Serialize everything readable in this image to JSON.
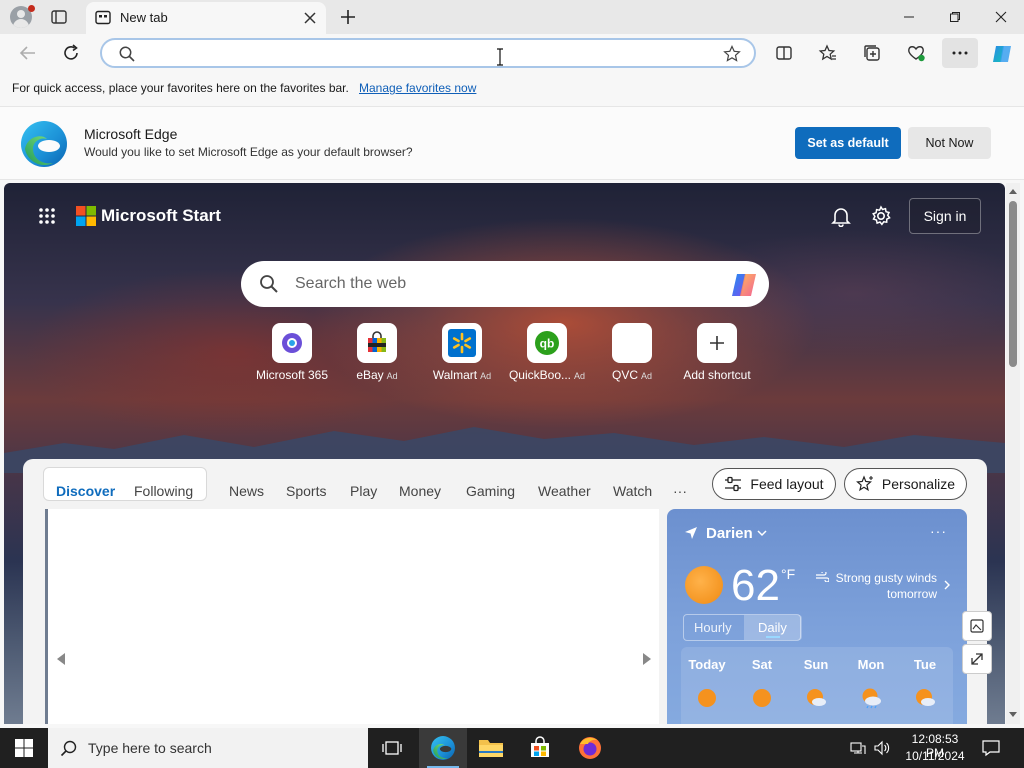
{
  "browser": {
    "tab_title": "New tab",
    "address_placeholder": "",
    "favorites_bar_text": "For quick access, place your favorites here on the favorites bar.",
    "favorites_bar_link": "Manage favorites now"
  },
  "banner": {
    "title": "Microsoft Edge",
    "subtitle": "Would you like to set Microsoft Edge as your default browser?",
    "set_default_label": "Set as default",
    "not_now_label": "Not Now"
  },
  "page": {
    "brand": "Microsoft Start",
    "signin_label": "Sign in",
    "search_placeholder": "Search the web",
    "shortcuts": [
      {
        "label": "Microsoft 365",
        "ad": ""
      },
      {
        "label": "eBay",
        "ad": "Ad"
      },
      {
        "label": "Walmart",
        "ad": "Ad"
      },
      {
        "label": "QuickBoo...",
        "ad": "Ad"
      },
      {
        "label": "QVC",
        "ad": "Ad"
      },
      {
        "label": "Add shortcut",
        "ad": ""
      }
    ]
  },
  "feed": {
    "tabs": [
      "Discover",
      "Following",
      "News",
      "Sports",
      "Play",
      "Money",
      "Gaming",
      "Weather",
      "Watch"
    ],
    "more_label": "···",
    "feed_layout_label": "Feed layout",
    "personalize_label": "Personalize"
  },
  "weather": {
    "location": "Darien",
    "temperature": "62",
    "unit": "°F",
    "summary": "Strong gusty winds tomorrow",
    "hourly_label": "Hourly",
    "daily_label": "Daily",
    "days": [
      "Today",
      "Sat",
      "Sun",
      "Mon",
      "Tue"
    ],
    "day_icons": [
      "sunny",
      "sunny",
      "partly-cloudy",
      "partly-cloudy-rain",
      "partly-cloudy"
    ]
  },
  "taskbar": {
    "search_placeholder": "Type here to search",
    "time": "12:08:53 PM",
    "date": "10/11/2024"
  },
  "colors": {
    "accent": "#0f6cbd",
    "taskbar": "#202020"
  }
}
